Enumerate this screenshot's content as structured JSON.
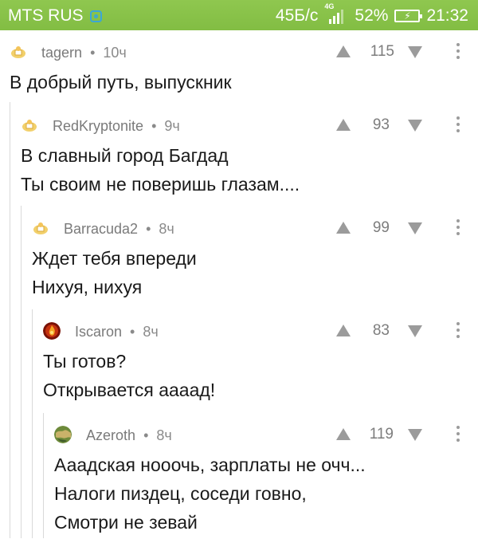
{
  "status_bar": {
    "carrier": "MTS RUS",
    "net_speed": "45Б/с",
    "network_type": "4G",
    "battery_percent": "52%",
    "time": "21:32",
    "carrier_icon": "carrier-app-icon",
    "signal_icon": "signal-bars-icon",
    "battery_icon": "battery-charging-icon"
  },
  "comments": [
    {
      "author": "tagern",
      "time": "10ч",
      "rating": "115",
      "lines": [
        "В добрый путь, выпускник"
      ]
    },
    {
      "author": "RedKryptonite",
      "time": "9ч",
      "rating": "93",
      "lines": [
        "В славный город Багдад",
        "Ты своим не поверишь глазам...."
      ]
    },
    {
      "author": "Barracuda2",
      "time": "8ч",
      "rating": "99",
      "lines": [
        "Ждет тебя впереди",
        "Нихуя, нихуя"
      ]
    },
    {
      "author": "Iscaron",
      "time": "8ч",
      "rating": "83",
      "lines": [
        "Ты готов?",
        "Открывается аааад!"
      ]
    },
    {
      "author": "Azeroth",
      "time": "8ч",
      "rating": "119",
      "lines": [
        "Ааадская нооочь, зарплаты не очч...",
        "Налоги пиздец, соседи говно,",
        "Смотри не зевай"
      ]
    }
  ],
  "separator": "•",
  "colors": {
    "status_bar": "#85bf47",
    "text": "#1a1a1a",
    "meta": "#8a8a8a",
    "vote_icon": "#9b9b9b",
    "thread_line": "#d9d9d9"
  }
}
